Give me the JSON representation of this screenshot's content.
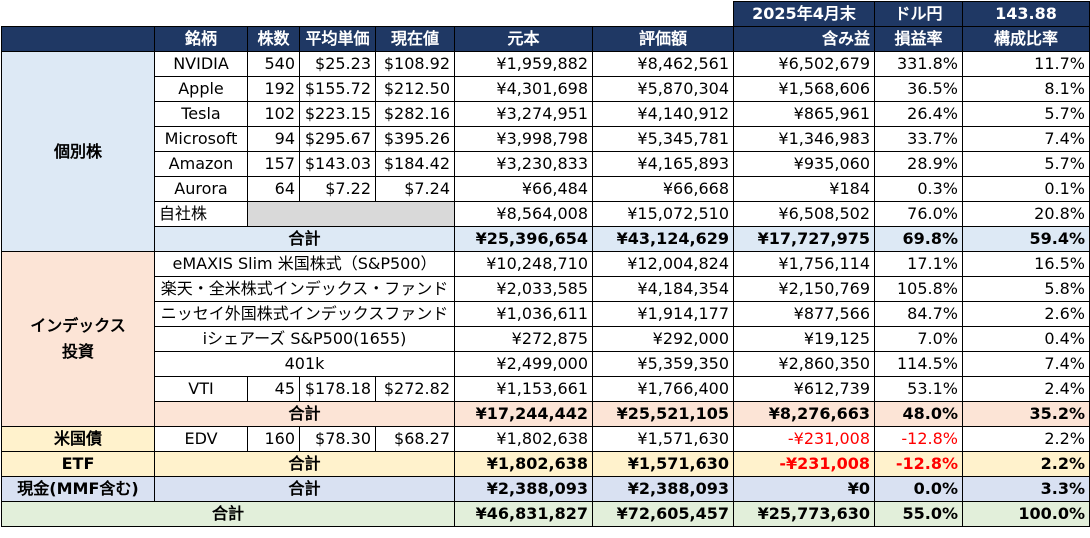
{
  "header_top": {
    "date": "2025年4月末",
    "fx_label": "ドル円",
    "fx_value": "143.88"
  },
  "columns": [
    "銘柄",
    "株数",
    "平均単価",
    "現在値",
    "元本",
    "評価額",
    "含み益",
    "損益率",
    "構成比率"
  ],
  "kobetsu": {
    "category": "個別株",
    "rows": [
      {
        "name": "NVIDIA",
        "shares": "540",
        "avg": "$25.23",
        "price": "$108.92",
        "principal": "¥1,959,882",
        "value": "¥8,462,561",
        "gain": "¥6,502,679",
        "rate": "331.8%",
        "ratio": "11.7%"
      },
      {
        "name": "Apple",
        "shares": "192",
        "avg": "$155.72",
        "price": "$212.50",
        "principal": "¥4,301,698",
        "value": "¥5,870,304",
        "gain": "¥1,568,606",
        "rate": "36.5%",
        "ratio": "8.1%"
      },
      {
        "name": "Tesla",
        "shares": "102",
        "avg": "$223.15",
        "price": "$282.16",
        "principal": "¥3,274,951",
        "value": "¥4,140,912",
        "gain": "¥865,961",
        "rate": "26.4%",
        "ratio": "5.7%"
      },
      {
        "name": "Microsoft",
        "shares": "94",
        "avg": "$295.67",
        "price": "$395.26",
        "principal": "¥3,998,798",
        "value": "¥5,345,781",
        "gain": "¥1,346,983",
        "rate": "33.7%",
        "ratio": "7.4%"
      },
      {
        "name": "Amazon",
        "shares": "157",
        "avg": "$143.03",
        "price": "$184.42",
        "principal": "¥3,230,833",
        "value": "¥4,165,893",
        "gain": "¥935,060",
        "rate": "28.9%",
        "ratio": "5.7%"
      },
      {
        "name": "Aurora",
        "shares": "64",
        "avg": "$7.22",
        "price": "$7.24",
        "principal": "¥66,484",
        "value": "¥66,668",
        "gain": "¥184",
        "rate": "0.3%",
        "ratio": "0.1%"
      },
      {
        "name": "自社株",
        "principal": "¥8,564,008",
        "value": "¥15,072,510",
        "gain": "¥6,508,502",
        "rate": "76.0%",
        "ratio": "20.8%"
      }
    ],
    "total": {
      "label": "合計",
      "principal": "¥25,396,654",
      "value": "¥43,124,629",
      "gain": "¥17,727,975",
      "rate": "69.8%",
      "ratio": "59.4%"
    }
  },
  "index": {
    "category_line1": "インデックス",
    "category_line2": "投資",
    "funds": [
      {
        "name": "eMAXIS Slim 米国株式（S&P500）",
        "principal": "¥10,248,710",
        "value": "¥12,004,824",
        "gain": "¥1,756,114",
        "rate": "17.1%",
        "ratio": "16.5%"
      },
      {
        "name": "楽天・全米株式インデックス・ファンド",
        "principal": "¥2,033,585",
        "value": "¥4,184,354",
        "gain": "¥2,150,769",
        "rate": "105.8%",
        "ratio": "5.8%"
      },
      {
        "name": "ニッセイ外国株式インデックスファンド",
        "principal": "¥1,036,611",
        "value": "¥1,914,177",
        "gain": "¥877,566",
        "rate": "84.7%",
        "ratio": "2.6%"
      },
      {
        "name": "iシェアーズ S&P500(1655)",
        "principal": "¥272,875",
        "value": "¥292,000",
        "gain": "¥19,125",
        "rate": "7.0%",
        "ratio": "0.4%"
      },
      {
        "name": "401k",
        "principal": "¥2,499,000",
        "value": "¥5,359,350",
        "gain": "¥2,860,350",
        "rate": "114.5%",
        "ratio": "7.4%"
      }
    ],
    "vti": {
      "name": "VTI",
      "shares": "45",
      "avg": "$178.18",
      "price": "$272.82",
      "principal": "¥1,153,661",
      "value": "¥1,766,400",
      "gain": "¥612,739",
      "rate": "53.1%",
      "ratio": "2.4%"
    },
    "total": {
      "label": "合計",
      "principal": "¥17,244,442",
      "value": "¥25,521,105",
      "gain": "¥8,276,663",
      "rate": "48.0%",
      "ratio": "35.2%"
    }
  },
  "bond": {
    "category_line1": "米国債",
    "category_line2": "ETF",
    "row": {
      "name": "EDV",
      "shares": "160",
      "avg": "$78.30",
      "price": "$68.27",
      "principal": "¥1,802,638",
      "value": "¥1,571,630",
      "gain": "-¥231,008",
      "rate": "-12.8%",
      "ratio": "2.2%"
    },
    "total": {
      "label": "合計",
      "principal": "¥1,802,638",
      "value": "¥1,571,630",
      "gain": "-¥231,008",
      "rate": "-12.8%",
      "ratio": "2.2%"
    }
  },
  "cash": {
    "category": "現金(MMF含む)",
    "label": "合計",
    "principal": "¥2,388,093",
    "value": "¥2,388,093",
    "gain": "¥0",
    "rate": "0.0%",
    "ratio": "3.3%"
  },
  "grand_total": {
    "label": "合計",
    "principal": "¥46,831,827",
    "value": "¥72,605,457",
    "gain": "¥25,773,630",
    "rate": "55.0%",
    "ratio": "100.0%"
  },
  "colors": {
    "header_bg": "#1f3864",
    "kobetsu_bg": "#dde9f5",
    "index_bg": "#fce4d6",
    "bond_bg": "#fff2cc",
    "cash_bg": "#d9e1f2",
    "grand_bg": "#e2efda",
    "negative": "#ff0000"
  }
}
